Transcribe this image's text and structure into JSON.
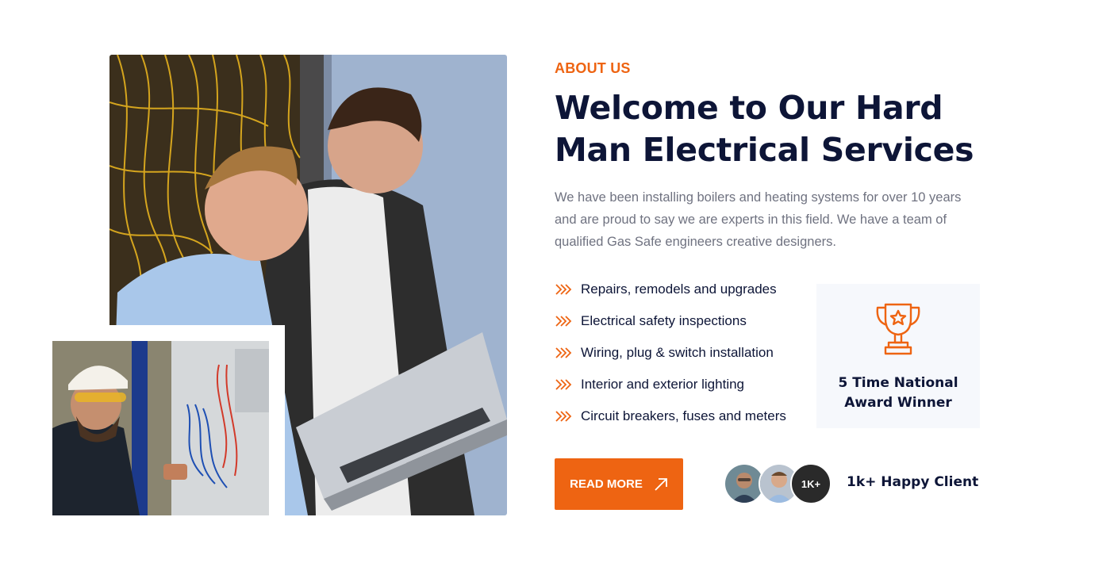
{
  "about": {
    "eyebrow": "ABOUT US",
    "title": "Welcome to Our Hard Man Electrical Services",
    "description": "We have been installing boilers and heating systems for over 10 years and are proud to say we are experts in this field. We have a team of qualified Gas Safe engineers creative designers.",
    "features": [
      "Repairs, remodels and upgrades",
      "Electrical safety inspections",
      "Wiring, plug & switch installation",
      "Interior and exterior lighting",
      "Circuit breakers, fuses and meters"
    ],
    "feature_icon": "double-chevron-right-icon"
  },
  "award": {
    "icon": "trophy-icon",
    "text": "5 Time National Award Winner"
  },
  "cta": {
    "read_more_label": "READ MORE",
    "icon": "arrow-up-right-icon"
  },
  "clients": {
    "count_badge": "1K+",
    "text": "1k+ Happy Client"
  },
  "colors": {
    "accent": "#ee6412",
    "heading": "#0d1537",
    "body_text": "#6f7280",
    "award_bg": "#f6f8fc"
  }
}
